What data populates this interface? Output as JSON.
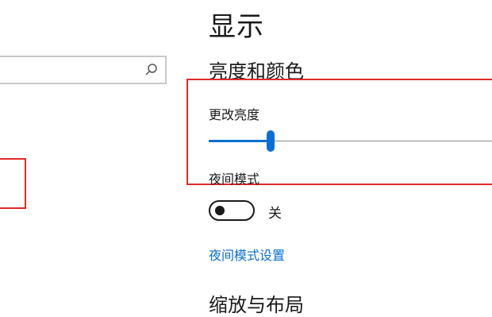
{
  "search": {
    "value": "",
    "icon": "search-icon"
  },
  "display": {
    "title": "显示",
    "brightness_section": {
      "heading": "亮度和颜色",
      "brightness_label": "更改亮度",
      "brightness_level_percent": 21,
      "night_mode_label": "夜间模式",
      "night_mode_state": "关",
      "night_mode_on": false,
      "night_mode_settings_link": "夜间模式设置"
    },
    "scale_section": {
      "heading": "缩放与布局"
    }
  },
  "colors": {
    "accent": "#0a6fd1",
    "highlight_border": "#e22a2a"
  }
}
